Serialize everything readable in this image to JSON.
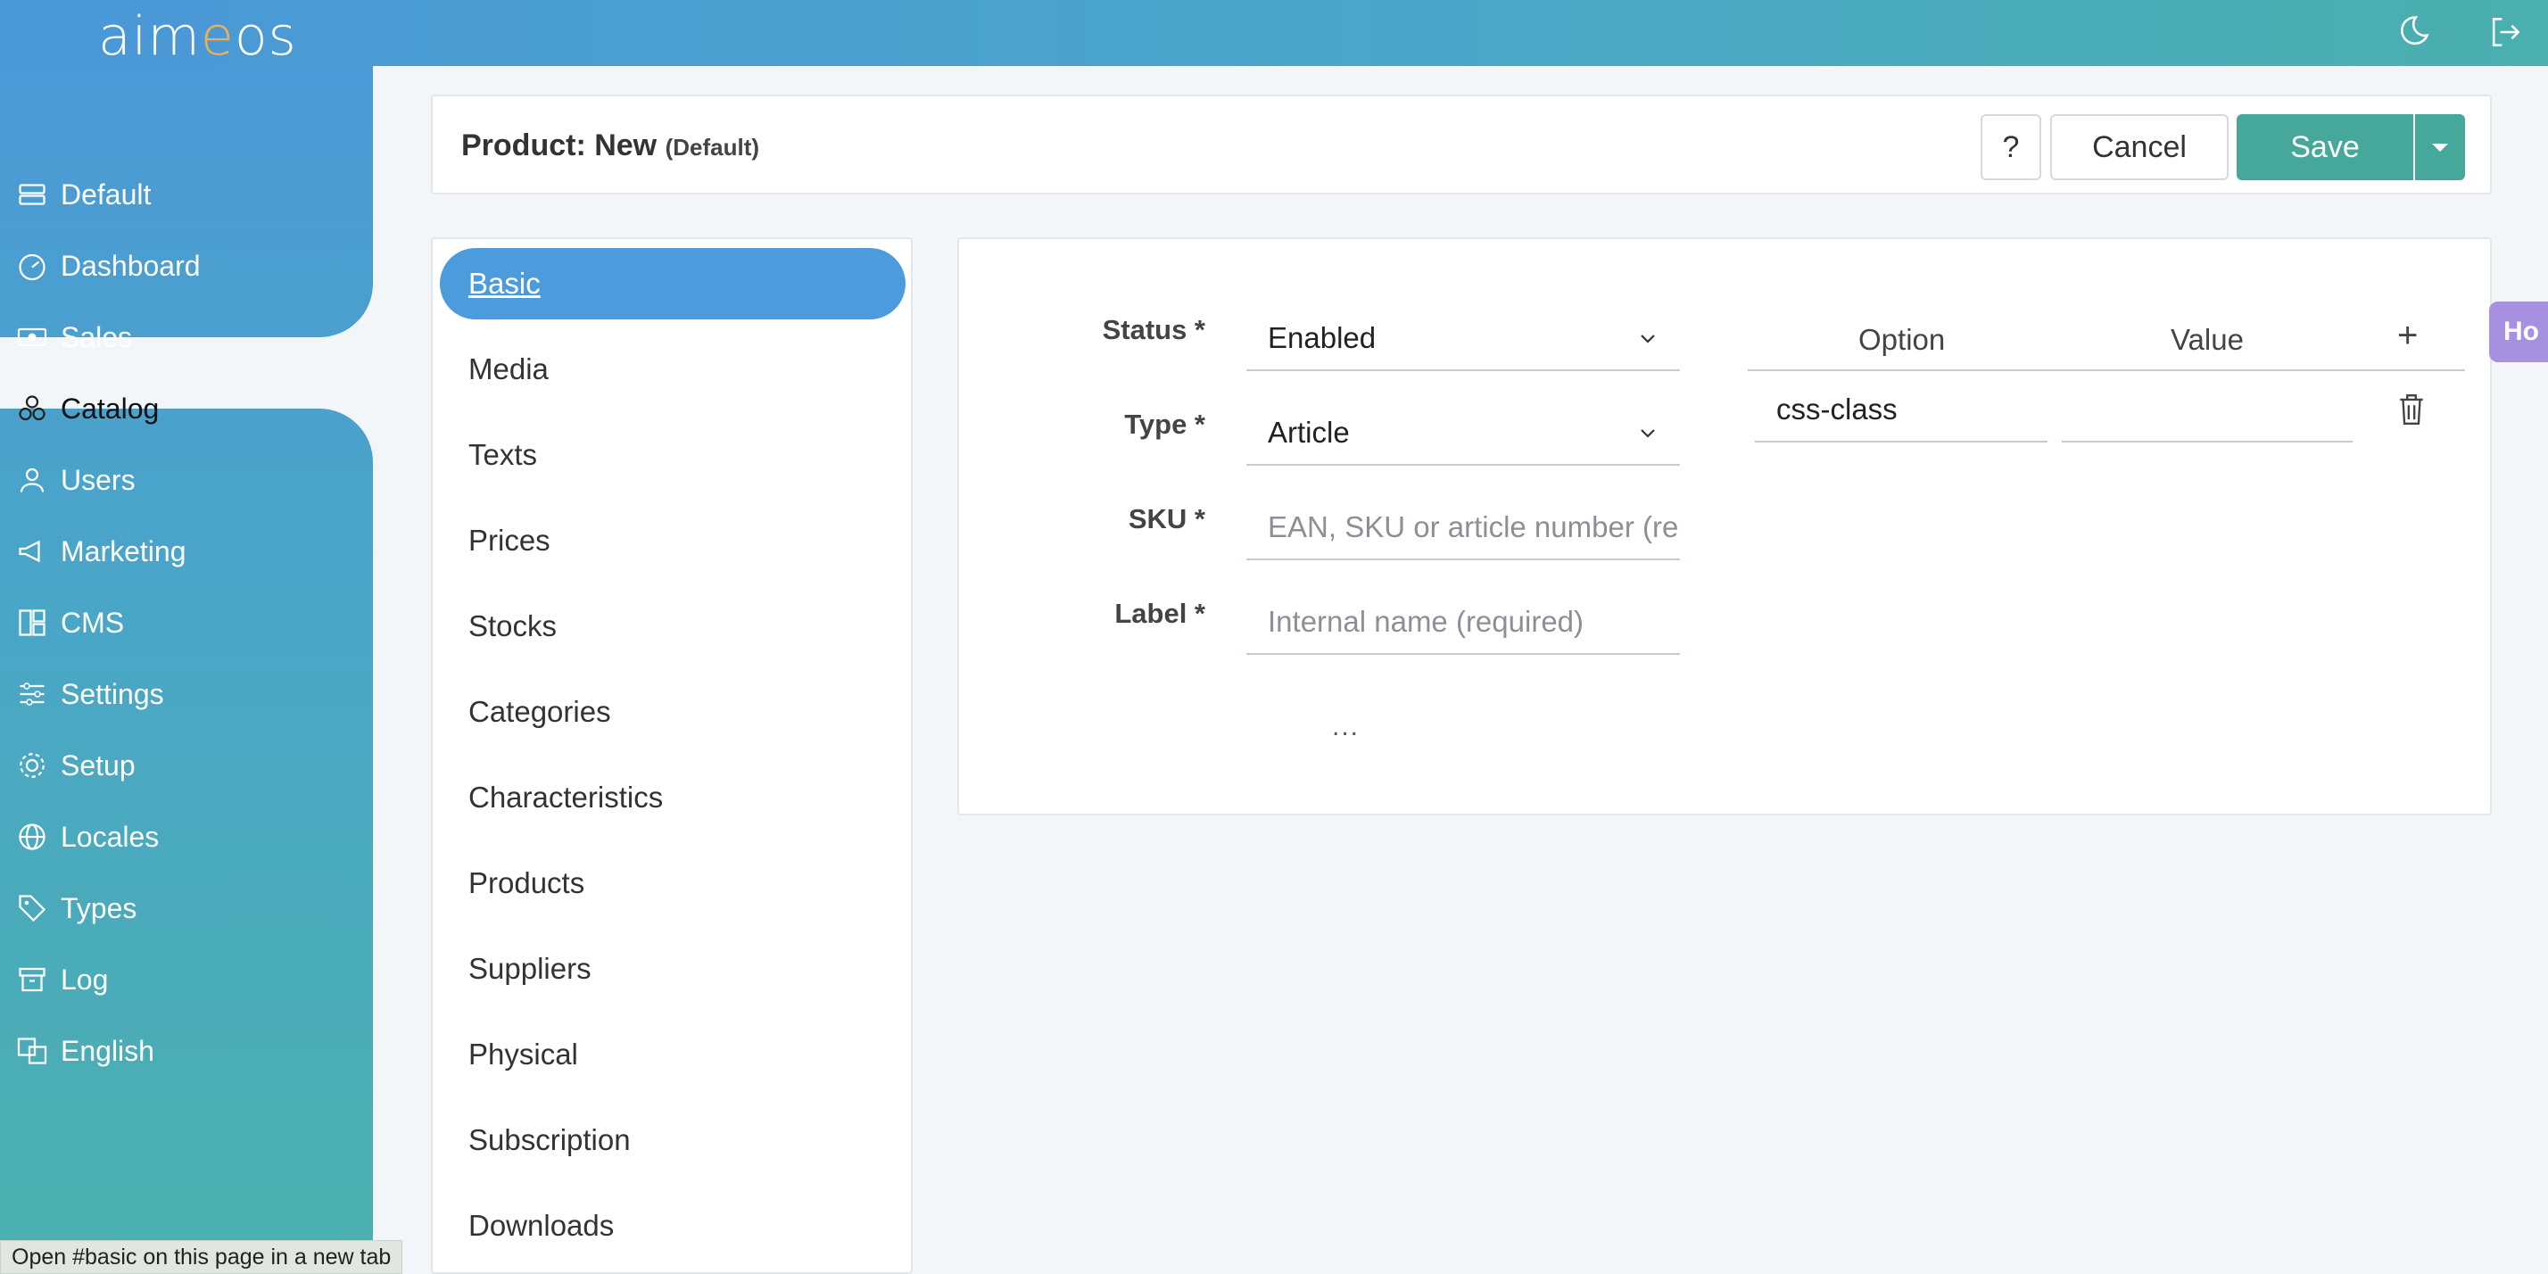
{
  "app": {
    "logo_text_a": "aim",
    "logo_text_e": "e",
    "logo_text_b": "os"
  },
  "topbar": {
    "theme_icon": "moon-icon",
    "logout_icon": "logout-icon"
  },
  "sidebar": {
    "items": [
      {
        "label": "Default",
        "icon": "site-icon"
      },
      {
        "label": "Dashboard",
        "icon": "dashboard-icon"
      },
      {
        "label": "Sales",
        "icon": "cash-icon"
      },
      {
        "label": "Catalog",
        "icon": "catalog-icon",
        "active": true
      },
      {
        "label": "Users",
        "icon": "user-icon"
      },
      {
        "label": "Marketing",
        "icon": "megaphone-icon"
      },
      {
        "label": "CMS",
        "icon": "layout-icon"
      },
      {
        "label": "Settings",
        "icon": "sliders-icon"
      },
      {
        "label": "Setup",
        "icon": "gear-icon"
      },
      {
        "label": "Locales",
        "icon": "globe-icon"
      },
      {
        "label": "Types",
        "icon": "tags-icon"
      },
      {
        "label": "Log",
        "icon": "archive-icon"
      },
      {
        "label": "English",
        "icon": "translate-icon"
      }
    ]
  },
  "header": {
    "title": "Product: New",
    "subtitle": "(Default)",
    "help_label": "?",
    "cancel_label": "Cancel",
    "save_label": "Save"
  },
  "tabs": [
    {
      "label": "Basic",
      "active": true
    },
    {
      "label": "Media"
    },
    {
      "label": "Texts"
    },
    {
      "label": "Prices"
    },
    {
      "label": "Stocks"
    },
    {
      "label": "Categories"
    },
    {
      "label": "Characteristics"
    },
    {
      "label": "Products"
    },
    {
      "label": "Suppliers"
    },
    {
      "label": "Physical"
    },
    {
      "label": "Subscription"
    },
    {
      "label": "Downloads"
    }
  ],
  "form": {
    "status_label": "Status *",
    "status_value": "Enabled",
    "type_label": "Type *",
    "type_value": "Article",
    "sku_label": "SKU *",
    "sku_placeholder": "EAN, SKU or article number (re",
    "label_label": "Label *",
    "label_placeholder": "Internal name (required)",
    "more": "..."
  },
  "config": {
    "option_header": "Option",
    "value_header": "Value",
    "add_label": "+",
    "rows": [
      {
        "option": "css-class",
        "value": ""
      }
    ]
  },
  "float_tab": {
    "label": "Ho"
  },
  "statusbar": {
    "text": "Open #basic on this page in a new tab"
  }
}
